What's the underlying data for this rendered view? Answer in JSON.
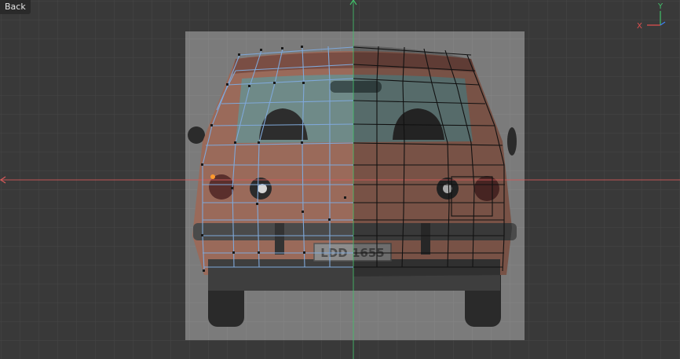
{
  "toolbar": {
    "back_label": "Back"
  },
  "gizmo": {
    "x_label": "X",
    "y_label": "Y"
  },
  "reference_image": {
    "plate_text": "LDD 1655"
  },
  "colors": {
    "x_axis": "#e05050",
    "y_axis": "#3fcf6a",
    "z_axis": "#3b82f6",
    "vertex_active": "#ff9a2e",
    "wire_selected": "#7fa8d9",
    "wire_unselected": "#111111"
  }
}
